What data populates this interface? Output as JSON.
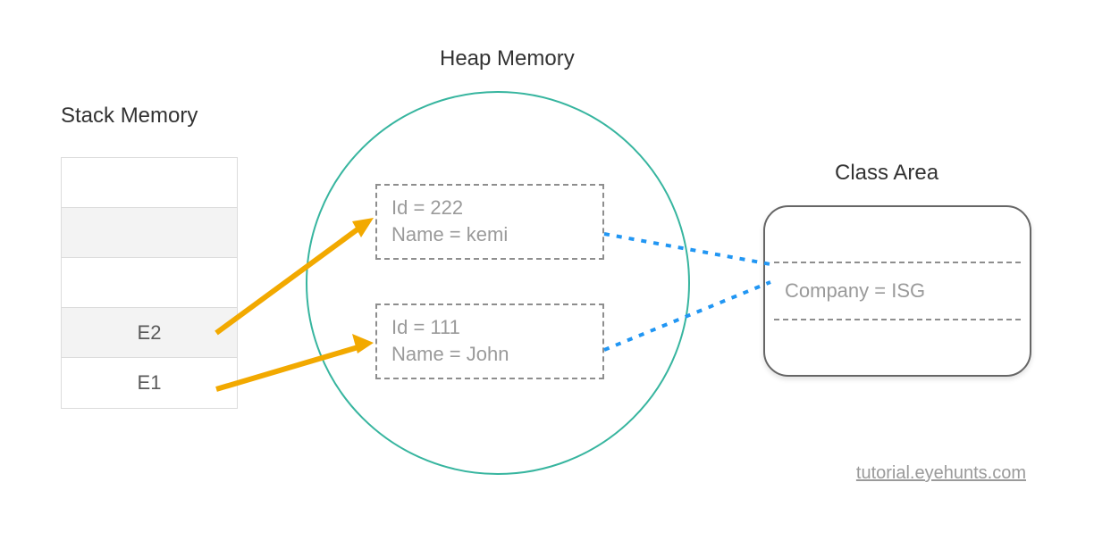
{
  "titles": {
    "stack": "Stack Memory",
    "heap": "Heap Memory",
    "classArea": "Class Area"
  },
  "stack": {
    "cells": [
      "",
      "",
      "",
      "E2",
      "E1"
    ]
  },
  "heap": {
    "objects": [
      {
        "idLine": "Id = 222",
        "nameLine": "Name = kemi"
      },
      {
        "idLine": "Id = 111",
        "nameLine": "Name = John"
      }
    ]
  },
  "classArea": {
    "line": "Company = ISG"
  },
  "footer": {
    "link": "tutorial.eyehunts.com"
  }
}
